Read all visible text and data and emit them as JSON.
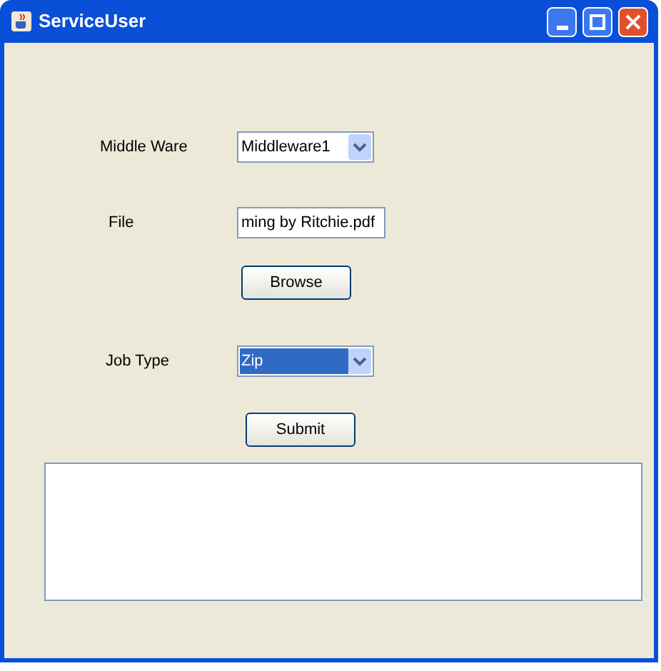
{
  "window": {
    "title": "ServiceUser"
  },
  "middleware": {
    "label": "Middle Ware",
    "value": "Middleware1",
    "highlighted": false
  },
  "file": {
    "label": "File",
    "value": "ming by Ritchie.pdf"
  },
  "browse_button": "Browse",
  "job_type": {
    "label": "Job Type",
    "value": "Zip",
    "highlighted": true
  },
  "submit_button": "Submit"
}
